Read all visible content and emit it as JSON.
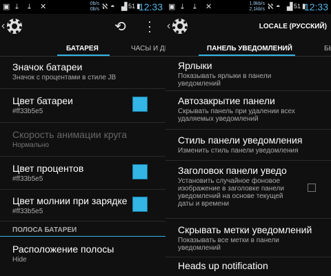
{
  "colors": {
    "accent": "#33b5e5",
    "background": "#101010",
    "clock": "#55b7e8"
  },
  "left": {
    "status": {
      "net_up": "0b/s",
      "net_down": "0b/s",
      "battery": "51",
      "time": "12:33"
    },
    "tabs": [
      {
        "label": "БАТАРЕЯ",
        "active": true
      },
      {
        "label": "ЧАСЫ И ДЕ",
        "active": false
      }
    ],
    "items": [
      {
        "title": "Значок батареи",
        "summary": "Значок с процентами в стиле JB"
      },
      {
        "title": "Цвет батареи",
        "summary": "#ff33b5e5",
        "swatch": true
      },
      {
        "title": "Скорость анимации круга",
        "summary": "Нормально",
        "disabled": true
      },
      {
        "title": "Цвет процентов",
        "summary": "#ff33b5e5",
        "swatch": true
      },
      {
        "title": "Цвет молнии при зарядке",
        "summary": "#ff33b5e5",
        "swatch": true
      }
    ],
    "category": "ПОЛОСА БАТАРЕИ",
    "item_after": {
      "title": "Расположение полосы",
      "summary": "Hide"
    }
  },
  "right": {
    "status": {
      "net_up": "1,9kb/s",
      "net_down": "2,1kb/s",
      "battery": "51",
      "time": "12:33"
    },
    "title": "LOCALE (РУССКИЙ)",
    "tabs": [
      {
        "label": "ПАНЕЛЬ УВЕДОМЛЕНИЙ",
        "active": true
      },
      {
        "label": "БЫ",
        "active": false
      }
    ],
    "items": [
      {
        "title": "Ярлыки",
        "summary": "Показывать ярлыки в панели уведомлений"
      },
      {
        "title": "Автозакрытие панели",
        "summary": "Скрывать панель при удалении всех удаляемых уведомлений"
      },
      {
        "title": "Стиль панели уведомления",
        "summary": "Изменить стиль панели уведомления"
      },
      {
        "title": "Заголовок панели уведо",
        "summary": "Установить случайное фоновое изображение в заголовке панели уведомлений на основе текущей даты и времени",
        "checkbox": true
      },
      {
        "title": "Скрывать метки уведомлений",
        "summary": "Показывать все метки в панели уведомлений"
      },
      {
        "title": "Heads up notification",
        "summary": ""
      }
    ]
  }
}
